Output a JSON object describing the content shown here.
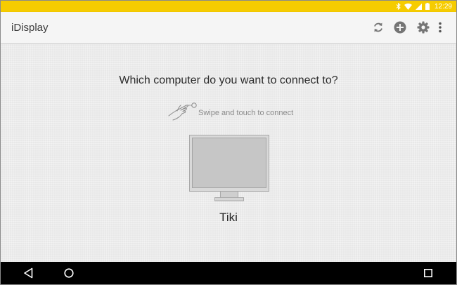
{
  "status_bar": {
    "time": "12:29",
    "icons": [
      "bluetooth-icon",
      "wifi-icon",
      "cellular-signal-icon",
      "battery-icon"
    ],
    "background_color": "#f6cc00"
  },
  "app_bar": {
    "title": "iDisplay",
    "actions": [
      "refresh-icon",
      "add-icon",
      "settings-icon",
      "overflow-menu-icon"
    ]
  },
  "main": {
    "prompt": "Which computer do you want to connect to?",
    "hint": "Swipe and touch to connect",
    "hint_icon": "swipe-gesture-icon",
    "computers": [
      {
        "name": "Tiki",
        "icon": "monitor-icon"
      }
    ]
  },
  "nav_bar": {
    "buttons": [
      "back-icon",
      "home-icon",
      "recents-icon"
    ]
  }
}
